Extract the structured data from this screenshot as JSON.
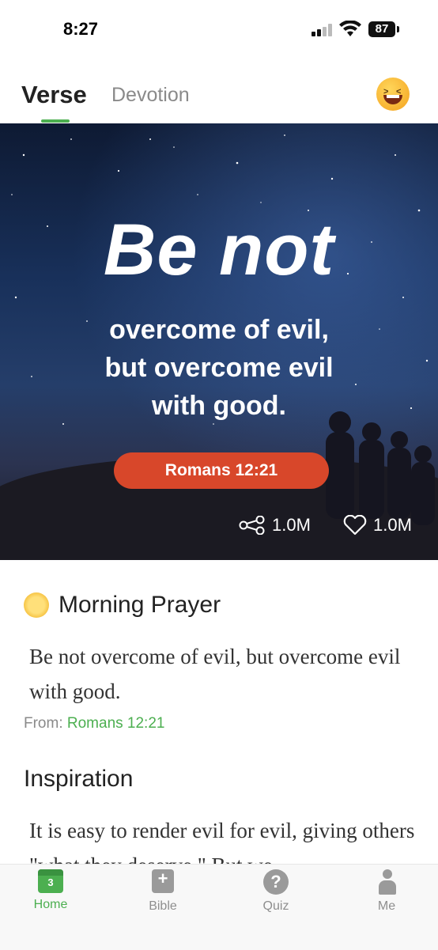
{
  "status_bar": {
    "time": "8:27",
    "battery": "87"
  },
  "tabs": {
    "verse": "Verse",
    "devotion": "Devotion"
  },
  "hero": {
    "big_title": "Be not",
    "line1": "overcome of evil,",
    "line2": "but overcome evil",
    "line3": "with good.",
    "reference": "Romans 12:21",
    "share_count": "1.0M",
    "like_count": "1.0M"
  },
  "prayer": {
    "title": "Morning Prayer",
    "text": "Be not overcome of evil, but overcome evil with good.",
    "from_label": "From: ",
    "from_ref": "Romans 12:21"
  },
  "inspiration": {
    "title": "Inspiration",
    "text": "It is easy to render evil for evil, giving others \"what they deserve.\" But we"
  },
  "nav": {
    "home": "Home",
    "home_badge": "3",
    "bible": "Bible",
    "quiz": "Quiz",
    "me": "Me"
  },
  "colors": {
    "accent": "#4caf50",
    "reference_pill": "#d8472a"
  }
}
